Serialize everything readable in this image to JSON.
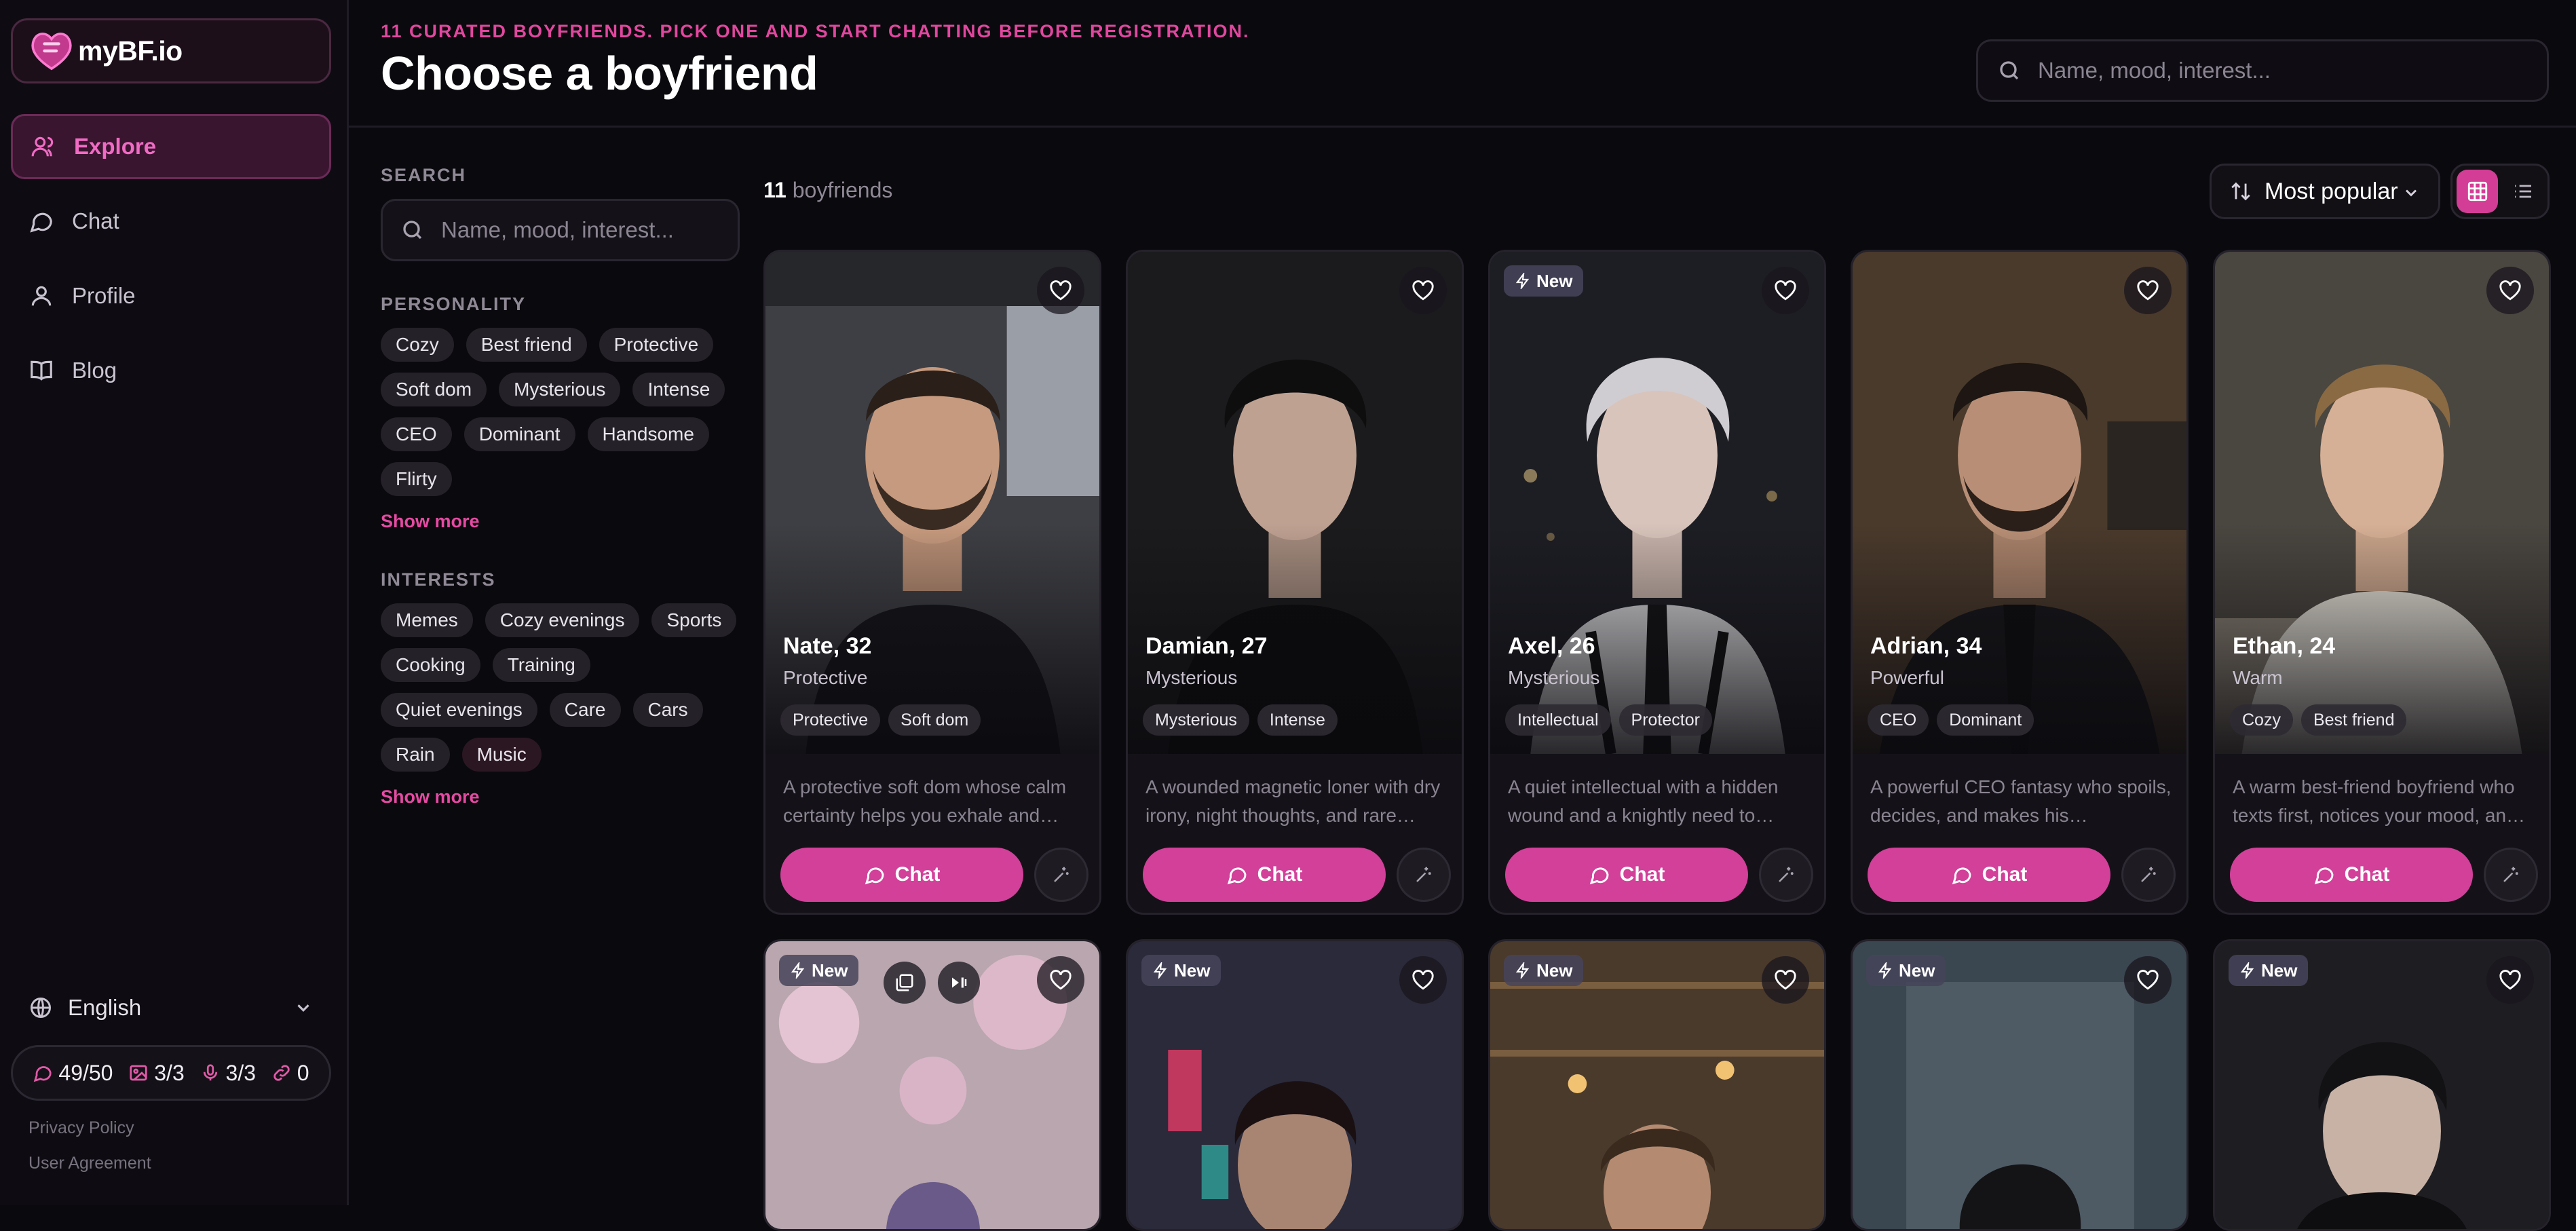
{
  "app": {
    "logo_text": "myBF.io"
  },
  "sidebar": {
    "nav": [
      {
        "label": "Explore",
        "icon": "users-icon",
        "active": true
      },
      {
        "label": "Chat",
        "icon": "chat-bubble-icon",
        "active": false
      },
      {
        "label": "Profile",
        "icon": "user-icon",
        "active": false
      },
      {
        "label": "Blog",
        "icon": "book-icon",
        "active": false
      }
    ],
    "language": "English",
    "quota": {
      "messages": "49/50",
      "images": "3/3",
      "voice": "3/3",
      "links": "0"
    },
    "footer": {
      "privacy": "Privacy Policy",
      "agreement": "User Agreement"
    }
  },
  "header": {
    "tagline": "11 CURATED BOYFRIENDS. PICK ONE AND START CHATTING BEFORE REGISTRATION.",
    "title": "Choose a boyfriend",
    "search_placeholder": "Name, mood, interest..."
  },
  "filters": {
    "search_label": "SEARCH",
    "search_placeholder": "Name, mood, interest...",
    "personality_label": "PERSONALITY",
    "personality": [
      "Cozy",
      "Best friend",
      "Protective",
      "Soft dom",
      "Mysterious",
      "Intense",
      "CEO",
      "Dominant",
      "Handsome",
      "Flirty"
    ],
    "interests_label": "INTERESTS",
    "interests": [
      "Memes",
      "Cozy evenings",
      "Sports",
      "Cooking",
      "Training",
      "Quiet evenings",
      "Care",
      "Cars",
      "Rain",
      "Music"
    ],
    "show_more": "Show more"
  },
  "results": {
    "count": "11",
    "count_suffix": "boyfriends",
    "sort": "Most popular",
    "view_mode": "grid"
  },
  "cards": [
    {
      "name": "Nate, 32",
      "mood": "Protective",
      "tags": [
        "Protective",
        "Soft dom"
      ],
      "desc": "A protective soft dom whose calm certainty helps you exhale and…",
      "new": false,
      "chat": "Chat"
    },
    {
      "name": "Damian, 27",
      "mood": "Mysterious",
      "tags": [
        "Mysterious",
        "Intense"
      ],
      "desc": "A wounded magnetic loner with dry irony, night thoughts, and rare…",
      "new": false,
      "chat": "Chat"
    },
    {
      "name": "Axel, 26",
      "mood": "Mysterious",
      "tags": [
        "Intellectual",
        "Protector"
      ],
      "desc": "A quiet intellectual with a hidden wound and a knightly need to…",
      "new": true,
      "chat": "Chat"
    },
    {
      "name": "Adrian, 34",
      "mood": "Powerful",
      "tags": [
        "CEO",
        "Dominant"
      ],
      "desc": "A powerful CEO fantasy who spoils, decides, and makes his…",
      "new": false,
      "chat": "Chat"
    },
    {
      "name": "Ethan, 24",
      "mood": "Warm",
      "tags": [
        "Cozy",
        "Best friend"
      ],
      "desc": "A warm best-friend boyfriend who texts first, notices your mood, an…",
      "new": false,
      "chat": "Chat"
    }
  ],
  "second_row": {
    "badge": "New"
  },
  "colors": {
    "accent": "#d2409a",
    "accent_text": "#f06bc4",
    "background": "#0a090d"
  }
}
